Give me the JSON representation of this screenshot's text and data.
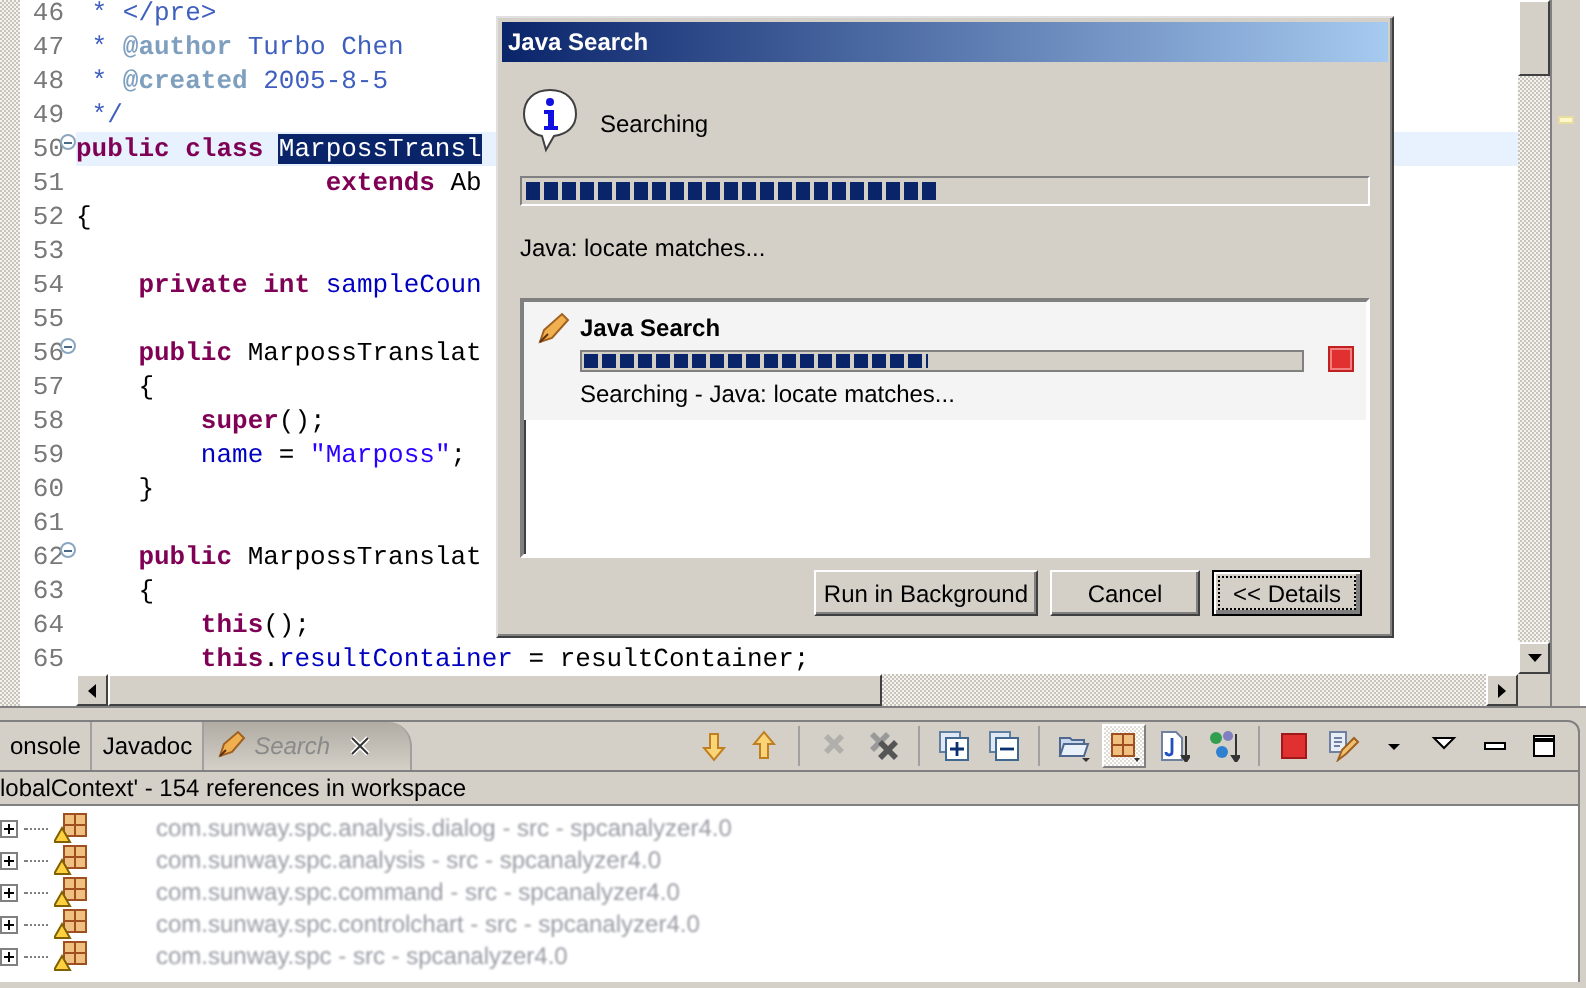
{
  "editor": {
    "lines": [
      {
        "number": "46",
        "current": false,
        "fold": false,
        "tokens": [
          {
            "kind": "comment",
            "text": " * </pre>"
          }
        ]
      },
      {
        "number": "47",
        "current": false,
        "fold": false,
        "tokens": [
          {
            "kind": "comment",
            "text": " * "
          },
          {
            "kind": "doctag",
            "text": "@author"
          },
          {
            "kind": "comment",
            "text": " Turbo Chen"
          }
        ]
      },
      {
        "number": "48",
        "current": false,
        "fold": false,
        "tokens": [
          {
            "kind": "comment",
            "text": " * "
          },
          {
            "kind": "doctag",
            "text": "@created"
          },
          {
            "kind": "comment",
            "text": " 2005-8-5"
          }
        ]
      },
      {
        "number": "49",
        "current": false,
        "fold": false,
        "tokens": [
          {
            "kind": "comment",
            "text": " */"
          }
        ]
      },
      {
        "number": "50",
        "current": true,
        "fold": true,
        "tokens": [
          {
            "kind": "keyword",
            "text": "public"
          },
          {
            "kind": "keyword",
            "text": " class "
          },
          {
            "kind": "selected",
            "text": "MarpossTransl"
          }
        ]
      },
      {
        "number": "51",
        "current": false,
        "fold": false,
        "tokens": [
          {
            "kind": "keyword",
            "text": "                extends"
          },
          {
            "kind": "plain",
            "text": " Ab"
          }
        ]
      },
      {
        "number": "52",
        "current": false,
        "fold": false,
        "tokens": [
          {
            "kind": "plain",
            "text": "{"
          }
        ]
      },
      {
        "number": "53",
        "current": false,
        "fold": false
      },
      {
        "number": "54",
        "current": false,
        "fold": false,
        "tokens": [
          {
            "kind": "keyword",
            "text": "    private"
          },
          {
            "kind": "keyword",
            "text": " int"
          },
          {
            "kind": "field",
            "text": " sampleCoun"
          }
        ]
      },
      {
        "number": "55",
        "current": false,
        "fold": false
      },
      {
        "number": "56",
        "current": false,
        "fold": true,
        "tokens": [
          {
            "kind": "keyword",
            "text": "    public"
          },
          {
            "kind": "plain",
            "text": " MarpossTranslat"
          }
        ]
      },
      {
        "number": "57",
        "current": false,
        "fold": false,
        "tokens": [
          {
            "kind": "plain",
            "text": "    {"
          }
        ]
      },
      {
        "number": "58",
        "current": false,
        "fold": false,
        "tokens": [
          {
            "kind": "keyword",
            "text": "        super"
          },
          {
            "kind": "plain",
            "text": "();"
          }
        ]
      },
      {
        "number": "59",
        "current": false,
        "fold": false,
        "tokens": [
          {
            "kind": "field",
            "text": "        name"
          },
          {
            "kind": "plain",
            "text": " = "
          },
          {
            "kind": "string",
            "text": "\"Marposs\""
          },
          {
            "kind": "plain",
            "text": ";"
          }
        ]
      },
      {
        "number": "60",
        "current": false,
        "fold": false,
        "tokens": [
          {
            "kind": "plain",
            "text": "    }"
          }
        ]
      },
      {
        "number": "61",
        "current": false,
        "fold": false
      },
      {
        "number": "62",
        "current": false,
        "fold": true,
        "tokens": [
          {
            "kind": "keyword",
            "text": "    public"
          },
          {
            "kind": "plain",
            "text": " MarpossTranslat"
          }
        ]
      },
      {
        "number": "63",
        "current": false,
        "fold": false,
        "tokens": [
          {
            "kind": "plain",
            "text": "    {"
          }
        ]
      },
      {
        "number": "64",
        "current": false,
        "fold": false,
        "tokens": [
          {
            "kind": "keyword",
            "text": "        this"
          },
          {
            "kind": "plain",
            "text": "();"
          }
        ]
      },
      {
        "number": "65",
        "current": false,
        "fold": false,
        "tokens": [
          {
            "kind": "keyword",
            "text": "        this"
          },
          {
            "kind": "plain",
            "text": "."
          },
          {
            "kind": "field",
            "text": "resultContainer"
          },
          {
            "kind": "plain",
            "text": " = resultContainer;"
          }
        ]
      }
    ]
  },
  "panel": {
    "tabs": [
      {
        "label": "onsole",
        "selected": false,
        "busy": false,
        "closable": false
      },
      {
        "label": "Javadoc",
        "selected": false,
        "busy": false,
        "closable": false
      },
      {
        "label": "Search",
        "selected": true,
        "busy": true,
        "closable": true
      }
    ],
    "toolbar": [
      {
        "kind": "next",
        "disabled": false,
        "selected": false
      },
      {
        "kind": "previous",
        "disabled": false,
        "selected": false
      },
      {
        "kind": "separator"
      },
      {
        "kind": "remove",
        "disabled": true,
        "selected": false
      },
      {
        "kind": "remove-all",
        "disabled": false,
        "selected": false
      },
      {
        "kind": "separator"
      },
      {
        "kind": "expand-all",
        "disabled": false,
        "selected": false
      },
      {
        "kind": "collapse-all",
        "disabled": false,
        "selected": false
      },
      {
        "kind": "separator"
      },
      {
        "kind": "folder",
        "disabled": false,
        "selected": false
      },
      {
        "kind": "package",
        "disabled": false,
        "selected": true
      },
      {
        "kind": "file",
        "disabled": false,
        "selected": false
      },
      {
        "kind": "hierarchy",
        "disabled": false,
        "selected": false
      },
      {
        "kind": "separator"
      },
      {
        "kind": "stop",
        "disabled": false,
        "selected": false
      },
      {
        "kind": "history",
        "disabled": false,
        "selected": false
      },
      {
        "kind": "dropdown",
        "disabled": false,
        "selected": false
      },
      {
        "kind": "view-menu",
        "disabled": false,
        "selected": false
      },
      {
        "kind": "minimize",
        "disabled": false,
        "selected": false
      },
      {
        "kind": "maximize",
        "disabled": false,
        "selected": false
      }
    ],
    "status": "lobalContext' - 154 references in workspace",
    "results": [
      {
        "label": "com.sunway.spc.analysis.dialog - src - spcanalyzer4.0",
        "expanded": false
      },
      {
        "label": "com.sunway.spc.analysis - src - spcanalyzer4.0",
        "expanded": false
      },
      {
        "label": "com.sunway.spc.command - src - spcanalyzer4.0",
        "expanded": false
      },
      {
        "label": "com.sunway.spc.controlchart - src - spcanalyzer4.0",
        "expanded": false
      },
      {
        "label": "com.sunway.spc - src - spcanalyzer4.0",
        "expanded": false
      }
    ]
  },
  "dialog": {
    "title": "Java Search",
    "message": "Searching",
    "level": 0.49,
    "task": "Java: locate matches...",
    "jobs": [
      {
        "name": "Java Search",
        "level": 0.48,
        "status": "Searching - Java: locate matches..."
      }
    ],
    "buttons": [
      {
        "label": "Run in Background",
        "default": false
      },
      {
        "label": "Cancel",
        "default": false
      },
      {
        "label": "<< Details",
        "default": true
      }
    ]
  }
}
